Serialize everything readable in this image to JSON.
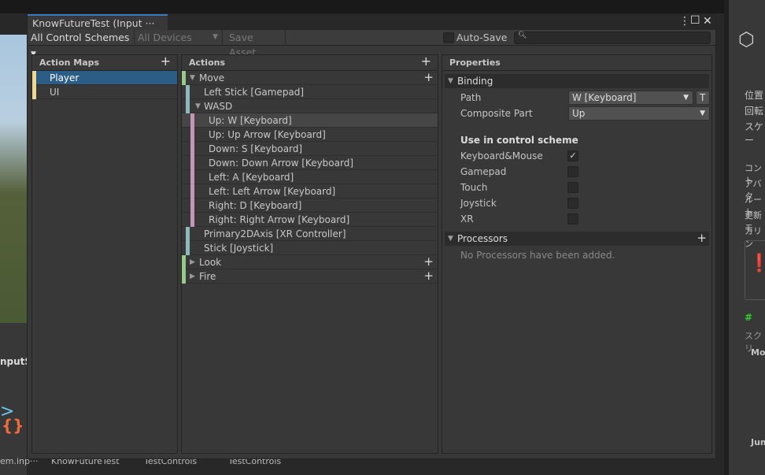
{
  "window": {
    "title": "KnowFutureTest (Input ···",
    "menu_icon": "kebab-icon",
    "maximize_icon": "maximize-icon",
    "close_icon": "close-icon"
  },
  "toolbar": {
    "control_schemes": "All Control Schemes",
    "devices": "All Devices",
    "save_asset": "Save Asset",
    "auto_save": "Auto-Save",
    "search_placeholder": ""
  },
  "action_maps": {
    "header": "Action Maps",
    "items": [
      {
        "label": "Player",
        "selected": true
      },
      {
        "label": "UI"
      }
    ]
  },
  "actions": {
    "header": "Actions",
    "rows": [
      {
        "label": "Move",
        "type": "action",
        "expanded": true
      },
      {
        "label": "Left Stick [Gamepad]",
        "type": "binding"
      },
      {
        "label": "WASD",
        "type": "composite",
        "expanded": true
      },
      {
        "label": "Up: W [Keyboard]",
        "type": "part",
        "selected": true
      },
      {
        "label": "Up: Up Arrow [Keyboard]",
        "type": "part"
      },
      {
        "label": "Down: S [Keyboard]",
        "type": "part"
      },
      {
        "label": "Down: Down Arrow [Keyboard]",
        "type": "part"
      },
      {
        "label": "Left: A [Keyboard]",
        "type": "part"
      },
      {
        "label": "Left: Left Arrow [Keyboard]",
        "type": "part"
      },
      {
        "label": "Right: D [Keyboard]",
        "type": "part"
      },
      {
        "label": "Right: Right Arrow [Keyboard]",
        "type": "part"
      },
      {
        "label": "Primary2DAxis [XR Controller]",
        "type": "binding"
      },
      {
        "label": "Stick [Joystick]",
        "type": "binding"
      },
      {
        "label": "Look",
        "type": "action",
        "expanded": false
      },
      {
        "label": "Fire",
        "type": "action",
        "expanded": false
      }
    ]
  },
  "properties": {
    "header": "Properties",
    "binding": {
      "title": "Binding",
      "path_label": "Path",
      "path_value": "W [Keyboard]",
      "t_button": "T",
      "composite_label": "Composite Part",
      "composite_value": "Up"
    },
    "schemes": {
      "title": "Use in control scheme",
      "items": [
        {
          "label": "Keyboard&Mouse",
          "checked": true
        },
        {
          "label": "Gamepad",
          "checked": false
        },
        {
          "label": "Touch",
          "checked": false
        },
        {
          "label": "Joystick",
          "checked": false
        },
        {
          "label": "XR",
          "checked": false
        }
      ]
    },
    "processors": {
      "title": "Processors",
      "empty": "No Processors have been added."
    }
  },
  "background": {
    "project_label": "nputS",
    "project_files": [
      "em.inp···",
      "KnowFutureTest",
      "TestControls",
      "TestControls"
    ],
    "inspector_rows": [
      "位置",
      "回転",
      "スケー",
      "コント",
      "アバタ",
      "ルート",
      "更新モ",
      "カリン",
      "スクリ",
      "Mov",
      "Jum"
    ]
  },
  "colors": {
    "action": "#96c98a",
    "binding": "#8fb8bd",
    "part": "#c695b6",
    "map": "#f0d98c",
    "selected": "#2c5d87",
    "tab_accent": "#3a79bb"
  }
}
